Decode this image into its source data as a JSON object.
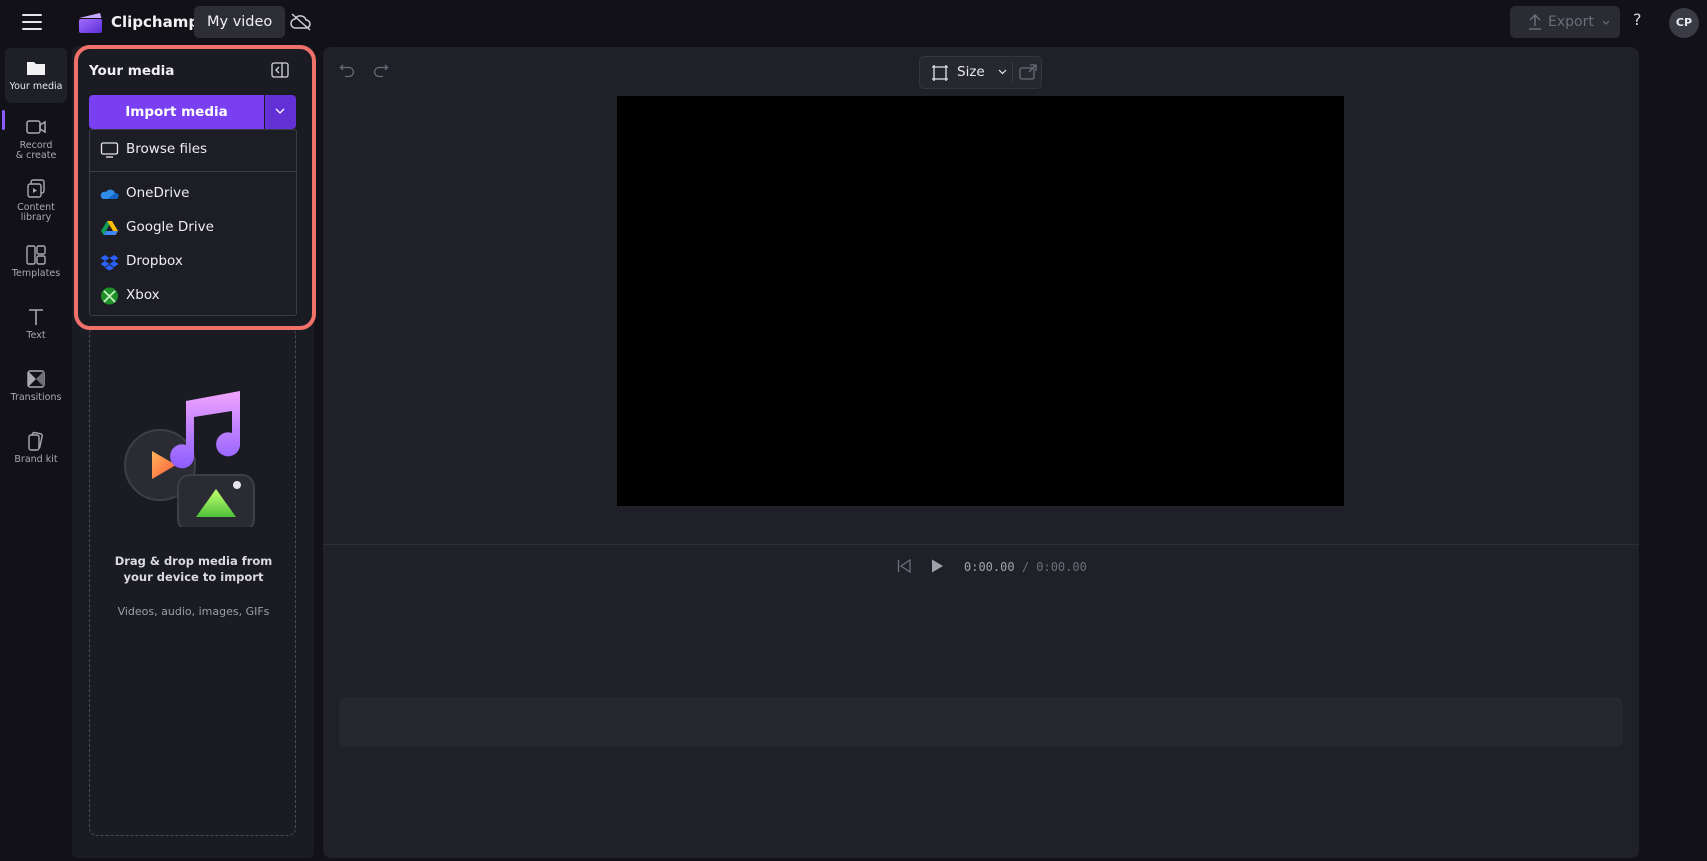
{
  "app": {
    "brand": "Clipchamp",
    "project_name": "My video",
    "export_label": "Export",
    "help_label": "?",
    "avatar_initials": "CP",
    "accent_color": "#7a3ff0"
  },
  "rail": {
    "items": [
      {
        "label": "Your media",
        "icon": "folder-icon",
        "active": true
      },
      {
        "label": "Record & create",
        "icon": "camera-icon",
        "active": false
      },
      {
        "label": "Content library",
        "icon": "content-library-icon",
        "active": false
      },
      {
        "label": "Templates",
        "icon": "templates-icon",
        "active": false
      },
      {
        "label": "Text",
        "icon": "text-icon",
        "active": false
      },
      {
        "label": "Transitions",
        "icon": "transitions-icon",
        "active": false
      },
      {
        "label": "Brand kit",
        "icon": "brand-kit-icon",
        "active": false
      }
    ]
  },
  "media_panel": {
    "title": "Your media",
    "import_label": "Import media",
    "menu": {
      "browse_files": "Browse files",
      "sources": [
        {
          "label": "OneDrive",
          "icon": "onedrive-icon"
        },
        {
          "label": "Google Drive",
          "icon": "google-drive-icon"
        },
        {
          "label": "Dropbox",
          "icon": "dropbox-icon"
        },
        {
          "label": "Xbox",
          "icon": "xbox-icon"
        }
      ]
    },
    "drop_title": "Drag & drop media from your device to import",
    "drop_subtitle": "Videos, audio, images, GIFs"
  },
  "stage": {
    "size_label": "Size",
    "time_current": "0:00.00",
    "time_total": "/ 0:00.00"
  }
}
